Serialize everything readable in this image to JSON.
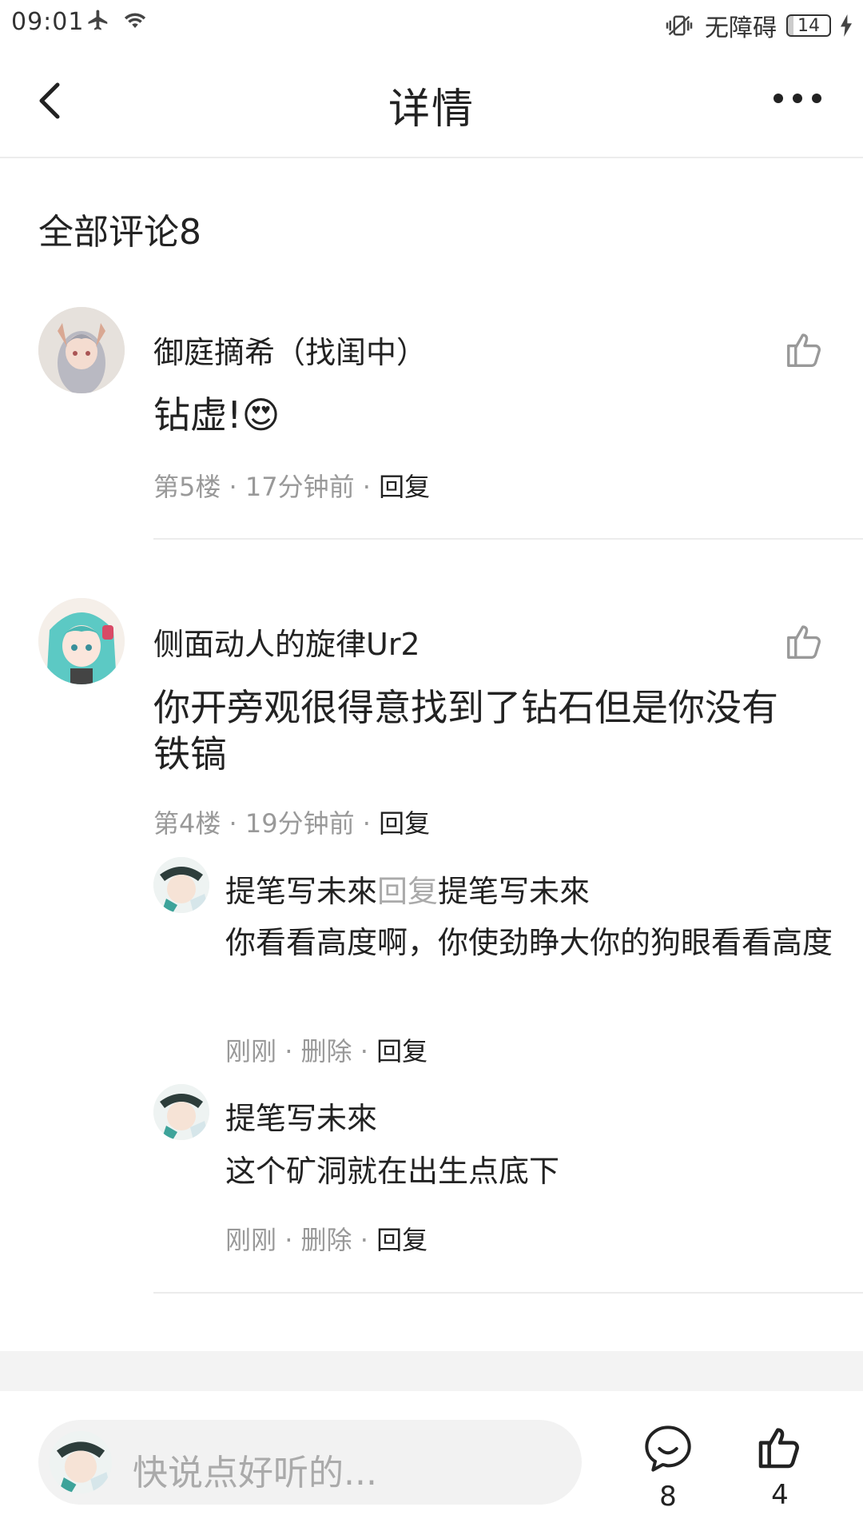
{
  "status_bar": {
    "time": "09:01",
    "accessibility": "无障碍",
    "battery": "14"
  },
  "nav": {
    "title": "详情"
  },
  "comments_header": "全部评论8",
  "comments": [
    {
      "name": "御庭摘希（找闺中）",
      "text": "钻虚!😍",
      "floor": "第5楼",
      "time": "17分钟前",
      "reply": "回复"
    },
    {
      "name": "侧面动人的旋律Ur2",
      "text_line1": "你开旁观很得意找到了钻石但是你没有",
      "text_line2": "铁镐",
      "floor": "第4楼",
      "time": "19分钟前",
      "reply": "回复",
      "replies": [
        {
          "name": "提笔写未來",
          "reply_word": "回复",
          "target": "提笔写未來",
          "text": "你看看高度啊，你使劲睁大你的狗眼看看高度",
          "time": "刚刚",
          "delete": "删除",
          "reply": "回复"
        },
        {
          "name": "提笔写未來",
          "text": "这个矿洞就在出生点底下",
          "time": "刚刚",
          "delete": "删除",
          "reply": "回复"
        }
      ]
    }
  ],
  "bottom_bar": {
    "placeholder": "快说点好听的...",
    "comment_count": "8",
    "like_count": "4"
  },
  "separator": "·",
  "icons": [
    "airplane-icon",
    "wifi-icon",
    "vibrate-icon",
    "back-icon",
    "more-icon",
    "thumbs-up-icon",
    "comment-bubble-icon"
  ]
}
